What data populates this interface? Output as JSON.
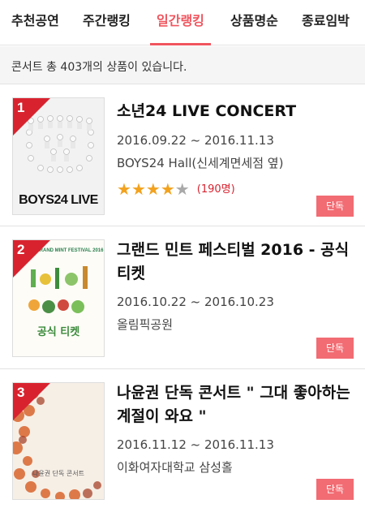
{
  "tabs": [
    {
      "label": "추천공연",
      "active": false
    },
    {
      "label": "주간랭킹",
      "active": false
    },
    {
      "label": "일간랭킹",
      "active": true
    },
    {
      "label": "상품명순",
      "active": false
    },
    {
      "label": "종료임박",
      "active": false
    }
  ],
  "count_text": "콘서트 총 403개의 상품이 있습니다.",
  "items": [
    {
      "rank": "1",
      "title": "소년24 LIVE CONCERT",
      "date": "2016.09.22 ~ 2016.11.13",
      "venue": "BOYS24 Hall(신세계면세점 옆)",
      "rating": 4,
      "rating_max": 5,
      "rating_count": "(190명)",
      "badge": "단독",
      "poster_caption": "BOYS24 LIVE"
    },
    {
      "rank": "2",
      "title": "그랜드 민트 페스티벌 2016 - 공식 티켓",
      "date": "2016.10.22 ~ 2016.10.23",
      "venue": "올림픽공원",
      "badge": "단독",
      "poster_header": "GRAND MINT FESTIVAL 2016",
      "poster_caption": "공식 티켓"
    },
    {
      "rank": "3",
      "title": "나윤권 단독 콘서트 \" 그대 좋아하는 계절이 와요 \"",
      "date": "2016.11.12 ~ 2016.11.13",
      "venue": "이화여자대학교 삼성홀",
      "badge": "단독",
      "poster_caption": "나윤권 단독 콘서트"
    }
  ],
  "colors": {
    "accent": "#f0555e",
    "rank_badge": "#d8232f",
    "exclusive_badge": "#f26c73",
    "star_on": "#f2a21e",
    "star_off": "#a9a9a9"
  },
  "icons": {
    "star": "star-icon"
  }
}
